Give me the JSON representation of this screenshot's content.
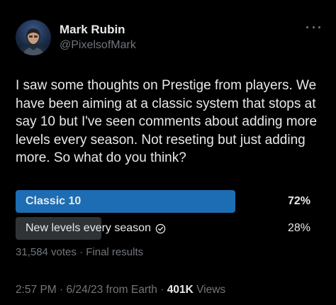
{
  "author": {
    "name": "Mark Rubin",
    "handle": "@PixelsofMark",
    "avatar_icon": "person-avatar"
  },
  "tweet": {
    "text": "I saw some thoughts on Prestige from players. We have been aiming at a classic system that stops at say 10 but I've seen comments about adding more levels every season. Not reseting but just adding more. So what do you think?"
  },
  "poll": {
    "options": [
      {
        "label": "Classic 10",
        "percent_text": "72%",
        "percent": 72,
        "winner": true
      },
      {
        "label": "New levels every season",
        "percent_text": "28%",
        "percent": 28,
        "winner": false,
        "voted": true
      }
    ],
    "votes_text": "31,584 votes",
    "separator": "·",
    "status_text": "Final results"
  },
  "footer": {
    "time": "2:57 PM",
    "separator": "·",
    "date": "6/24/23 from Earth",
    "views_count": "401K",
    "views_label": "Views"
  },
  "colors": {
    "background": "#000000",
    "winner_bar": "#1d6db4",
    "other_bar": "#2f3336",
    "muted_text": "#71767b",
    "primary_text": "#e7e9ea"
  },
  "icons": {
    "more": "more-horizontal-icon",
    "voted": "check-circle-icon"
  }
}
